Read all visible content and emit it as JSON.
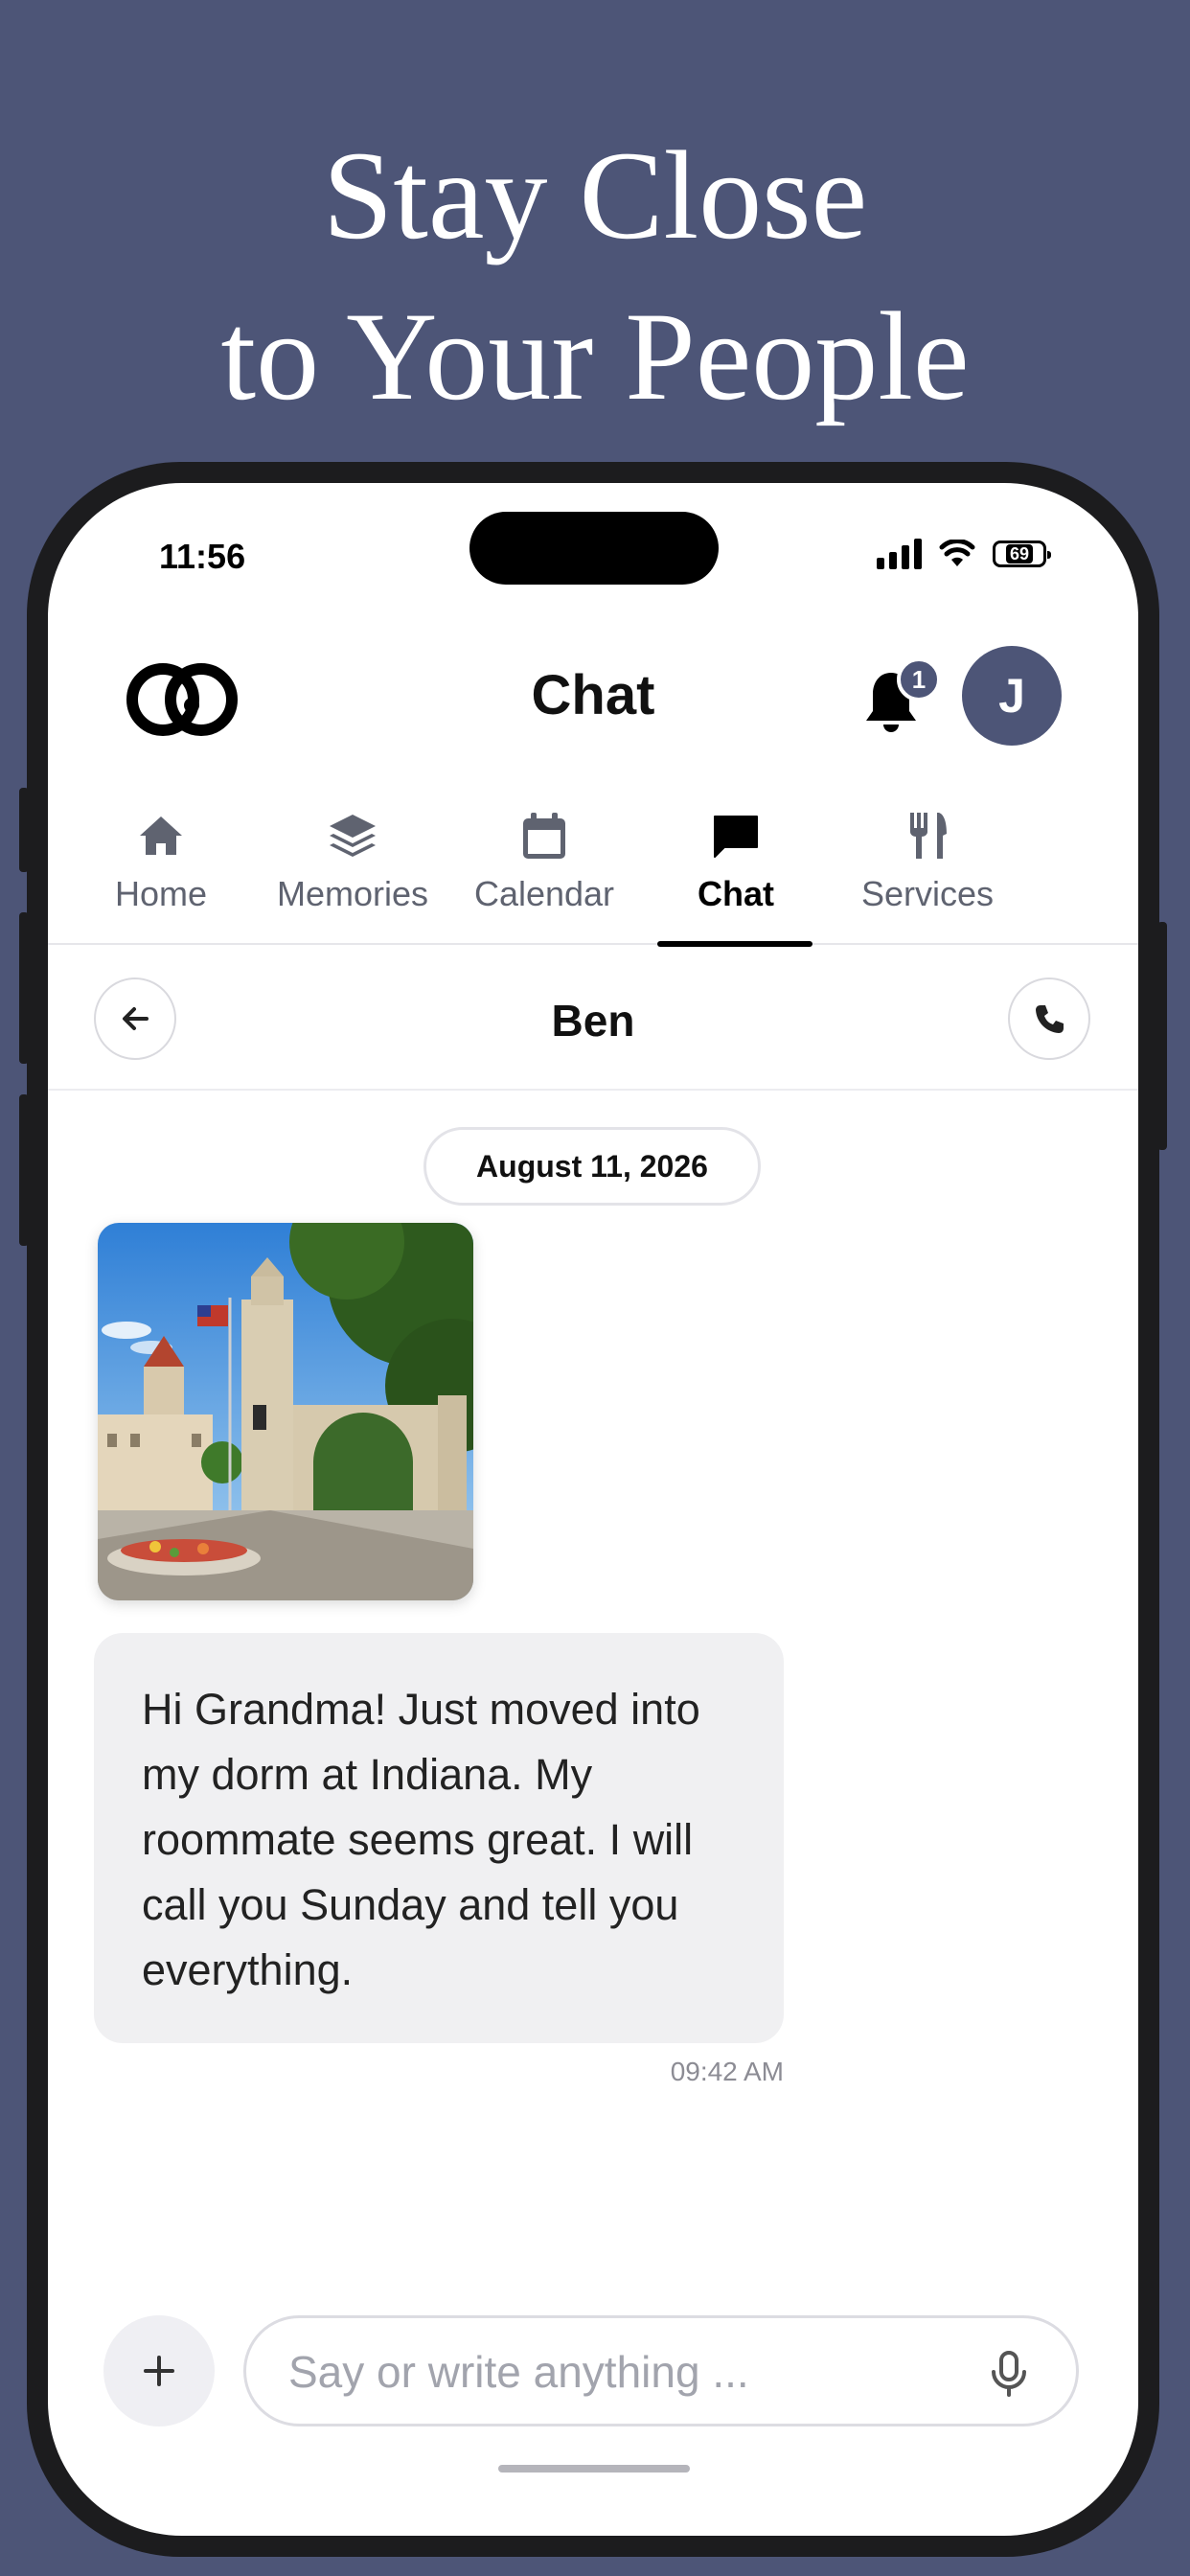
{
  "headline": {
    "line1": "Stay Close",
    "line2": "to Your People"
  },
  "status_bar": {
    "time": "11:56",
    "battery": "69"
  },
  "header": {
    "title": "Chat",
    "notification_count": "1",
    "avatar_initial": "J"
  },
  "tabs": [
    {
      "label": "Home",
      "icon": "home-icon"
    },
    {
      "label": "Memories",
      "icon": "layers-icon"
    },
    {
      "label": "Calendar",
      "icon": "calendar-icon"
    },
    {
      "label": "Chat",
      "icon": "chat-bubble-icon",
      "active": true
    },
    {
      "label": "Services",
      "icon": "fork-knife-icon"
    }
  ],
  "conversation": {
    "contact_name": "Ben",
    "date": "August 11, 2026",
    "message": "Hi Grandma! Just moved into my dorm at Indiana. My roommate seems great. I will call you Sunday and tell you everything.",
    "message_time": "09:42 AM"
  },
  "composer": {
    "placeholder": "Say or write anything ..."
  },
  "colors": {
    "brand": "#4d5577",
    "bubble": "#f0f0f2",
    "active_tab": "#000000",
    "inactive_tab": "#5f6370"
  }
}
